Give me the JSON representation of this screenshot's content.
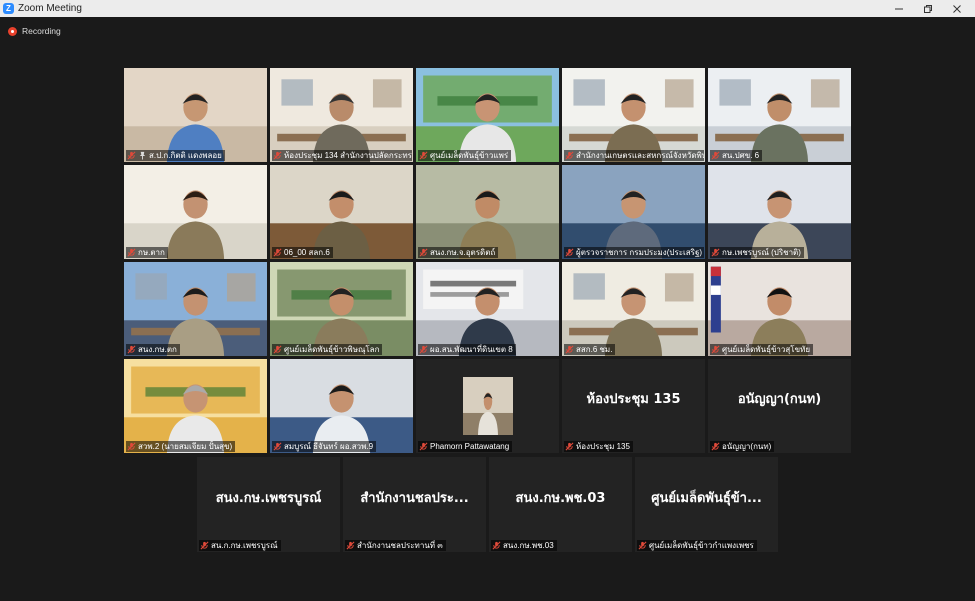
{
  "window": {
    "title": "Zoom Meeting",
    "app_icon": "zoom-logo-icon"
  },
  "recording": {
    "label": "Recording",
    "color": "#e8412c"
  },
  "active_speaker_color": "#d8dc2a",
  "participants": [
    {
      "name": "ส.ป.ก.กิตติ แดงพลอย",
      "pinned": true
    },
    {
      "name": "ห้องประชุม 134 สำนักงานปลัดกระทรวงเกษ..."
    },
    {
      "name": "ศูนย์เมล็ดพันธุ์ข้าวแพร่"
    },
    {
      "name": "สำนักงานเกษตรและสหกรณ์จังหวัดพิษณ..."
    },
    {
      "name": "สน.ปศข. 6"
    },
    {
      "name": "กษ.ตาก"
    },
    {
      "name": "06_00 สลก.6"
    },
    {
      "name": "สนง.กษ.จ.อุตรดิตถ์",
      "active": true
    },
    {
      "name": "ผู้ตรวจราชการ กรมประมง(ประเสริฐ)"
    },
    {
      "name": "กษ.เพชรบูรณ์ (ปริชาติ)"
    },
    {
      "name": "สนง.กษ.ตก"
    },
    {
      "name": "ศูนย์เมล็ดพันธุ์ข้าวพิษณุโลก"
    },
    {
      "name": "ผอ.สน.พัฒนาที่ดินเขต 8"
    },
    {
      "name": "สสก.6 ชม."
    },
    {
      "name": "ศูนย์เมล็ดพันธุ์ข้าวสุโขทัย"
    },
    {
      "name": "สวพ.2 (นายสมเจียม ปั้นสุข)"
    },
    {
      "name": "สมบูรณ์ ธีจันทร์ ผอ.สวพ.9"
    },
    {
      "name": "Phamorn Pattawatang"
    },
    {
      "name": "ห้องประชุม 135",
      "display": "ห้องประชุม 135"
    },
    {
      "name": "อนัญญา(กนท)",
      "display": "อนัญญา(กนท)"
    },
    {
      "name": "สน.ก.กษ.เพชรบูรณ์",
      "display": "สนง.กษ.เพชรบูรณ์"
    },
    {
      "name": "สำนักงานชลประทานที่ ๓",
      "display": "สำนักงานชลประ..."
    },
    {
      "name": "สนง.กษ.พช.03",
      "display": "สนง.กษ.พช.03"
    },
    {
      "name": "ศูนย์เมล็ดพันธุ์ข้าวกำแพงเพชร",
      "display": "ศูนย์เมล็ดพันธุ์ข้า..."
    }
  ]
}
